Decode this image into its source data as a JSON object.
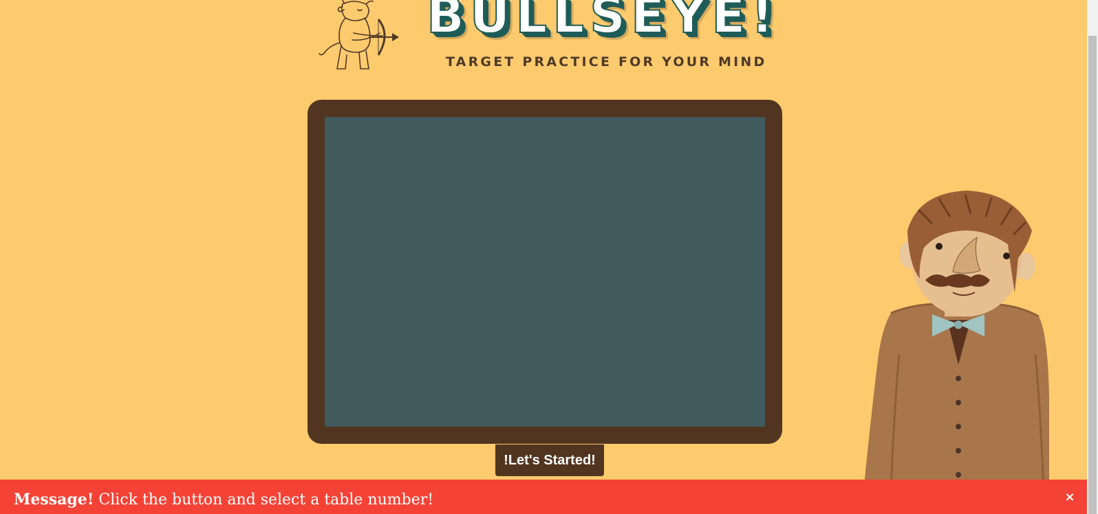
{
  "header": {
    "title": "BULLSEYE!",
    "subtitle": "TARGET PRACTICE FOR YOUR MIND",
    "mascot_icon": "bull-archer-icon"
  },
  "board": {
    "start_button_label": "!Let's Started!"
  },
  "character": {
    "icon": "professor-mustache-icon"
  },
  "message_bar": {
    "label": "Message!",
    "text": " Click the button and select a table number!",
    "close_label": "×"
  },
  "colors": {
    "background": "#fdca6d",
    "board_frame": "#513520",
    "board_surface": "#415a5d",
    "title_teal": "#1f5c58",
    "message_red": "#f44336"
  }
}
